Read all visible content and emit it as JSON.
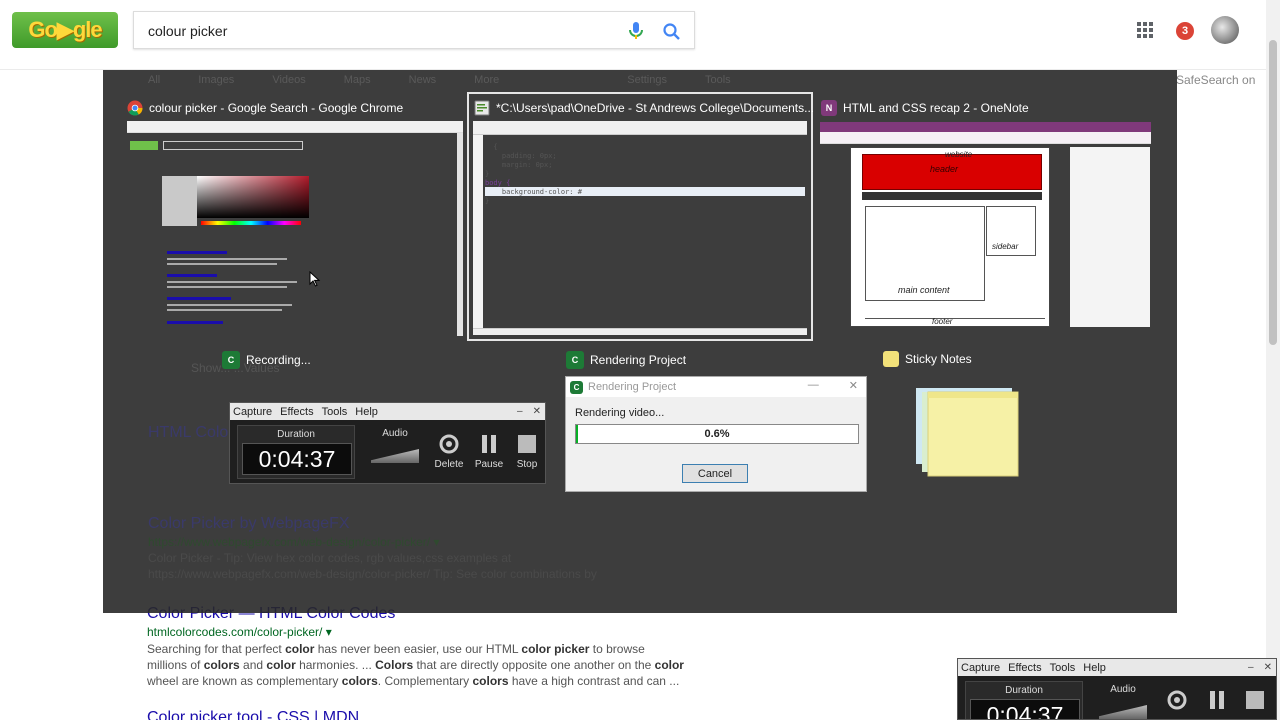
{
  "google": {
    "logo_text": "Go▶gle",
    "search_value": "colour picker",
    "notification_count": "3",
    "safesearch": "SafeSearch on",
    "faint_tabs": [
      "All",
      "Images",
      "Videos",
      "Maps",
      "News",
      "More",
      "Settings",
      "Tools"
    ],
    "show_more": "Show... ...Values"
  },
  "results": [
    {
      "title": "HTML Color...",
      "url": "",
      "snippet": ""
    },
    {
      "title": "Color Picker by WebpageFX",
      "url": "https://www.webpagefx.com/web-design/color-picker/ ▾",
      "snippet": "Color Picker - Tip: View hex color codes, rgb values,css examples at https://www.webpagefx.com/web-design/color-picker/ Tip: See color combinations by"
    },
    {
      "title": "Color Picker — HTML Color Codes",
      "url": "htmlcolorcodes.com/color-picker/ ▾",
      "snippet_parts": [
        "Searching for that perfect ",
        "color",
        " has never been easier, use our HTML ",
        "color picker",
        " to browse millions of ",
        "colors",
        " and ",
        "color",
        " harmonies. ... ",
        "Colors",
        " that are directly opposite one another on the ",
        "color",
        " wheel are known as complementary ",
        "colors",
        ". Complementary ",
        "colors",
        " have a high contrast and can ..."
      ]
    },
    {
      "title": "Color picker tool - CSS | MDN"
    }
  ],
  "alttab": {
    "windows": [
      {
        "title": "colour picker - Google Search - Google Chrome",
        "icon": "chrome-icon"
      },
      {
        "title": "*C:\\Users\\pad\\OneDrive - St Andrews College\\Documents...",
        "icon": "editor-icon",
        "selected": true
      },
      {
        "title": "HTML and CSS recap 2 - OneNote",
        "icon": "onenote-icon"
      }
    ],
    "code_lines": [
      "  {",
      "    padding: 0px;",
      "    margin: 0px;",
      "}",
      "body {",
      "    background-color: #",
      "}"
    ],
    "onenote_labels": {
      "header": "header",
      "main": "main content",
      "footer": "footer",
      "sidebar": "sidebar",
      "website": "website"
    },
    "row2": [
      {
        "title": "Recording...",
        "icon": "camtasia-icon"
      },
      {
        "title": "Rendering Project",
        "icon": "camtasia-icon"
      },
      {
        "title": "Sticky Notes",
        "icon": "sticky-notes-icon"
      }
    ]
  },
  "recorder": {
    "menu": [
      "Capture",
      "Effects",
      "Tools",
      "Help"
    ],
    "minimize": "‒",
    "close": "✕",
    "duration_label": "Duration",
    "duration": "0:04:37",
    "audio_label": "Audio",
    "delete_label": "Delete",
    "pause_label": "Pause",
    "stop_label": "Stop"
  },
  "render": {
    "title": "Rendering Project",
    "message": "Rendering video...",
    "progress_text": "0.6%",
    "progress": 0.006,
    "cancel_label": "Cancel",
    "minimize": "—",
    "close": "✕"
  },
  "colors": {
    "overlay": "#282828",
    "link": "#1a0dab",
    "url": "#006621",
    "progress": "#06b025",
    "notif": "#db4437"
  }
}
